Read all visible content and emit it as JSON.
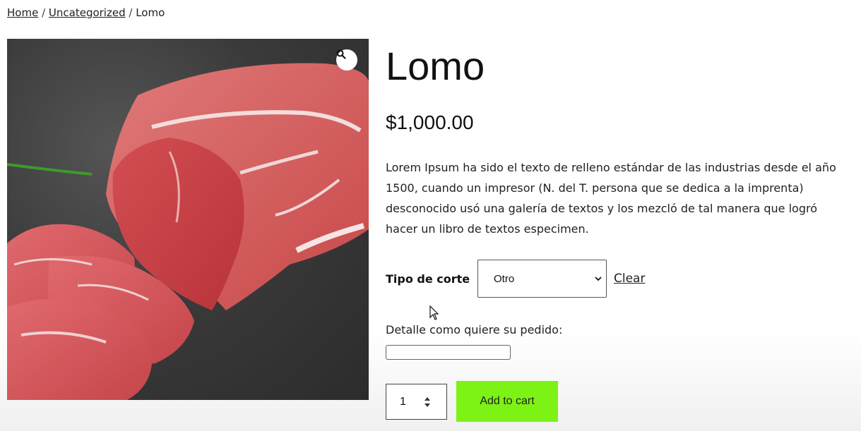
{
  "breadcrumb": {
    "home": "Home",
    "sep1": "/",
    "category": "Uncategorized",
    "sep2": "/",
    "current": "Lomo"
  },
  "gallery": {
    "image": "raw-beef-loin-photo",
    "zoom_icon": "magnifier-icon"
  },
  "product": {
    "title": "Lomo",
    "price": "$1,000.00",
    "description": "Lorem Ipsum ha sido el texto de relleno estándar de las industrias desde el año 1500, cuando un impresor (N. del T. persona que se dedica a la imprenta) desconocido usó una galería de textos y los mezcló de tal manera que logró hacer un libro de textos especimen."
  },
  "variation": {
    "label": "Tipo de corte",
    "selected": "Otro",
    "clear": "Clear"
  },
  "detail": {
    "label": "Detalle como quiere su pedido:",
    "value": ""
  },
  "cart": {
    "quantity": "1",
    "button": "Add to cart",
    "button_color": "#7df215"
  }
}
